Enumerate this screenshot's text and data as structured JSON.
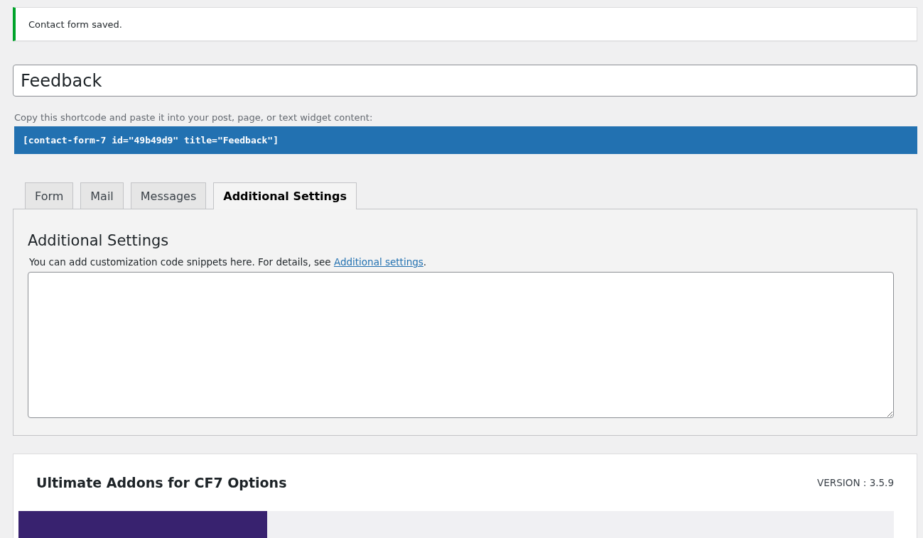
{
  "notice": {
    "text": "Contact form saved."
  },
  "title_field": {
    "value": "Feedback"
  },
  "shortcode": {
    "label": "Copy this shortcode and paste it into your post, page, or text widget content:",
    "code": "[contact-form-7 id=\"49b49d9\" title=\"Feedback\"]"
  },
  "tabs": [
    {
      "label": "Form",
      "selected": false
    },
    {
      "label": "Mail",
      "selected": false
    },
    {
      "label": "Messages",
      "selected": false
    },
    {
      "label": "Additional Settings",
      "selected": true
    }
  ],
  "panel": {
    "heading": "Additional Settings",
    "description": "You can add customization code snippets here. For details, see ",
    "link": "Additional settings",
    "description_end": "."
  },
  "addon_card": {
    "title": "Ultimate Addons for CF7 Options",
    "version": "VERSION : 3.5.9"
  }
}
